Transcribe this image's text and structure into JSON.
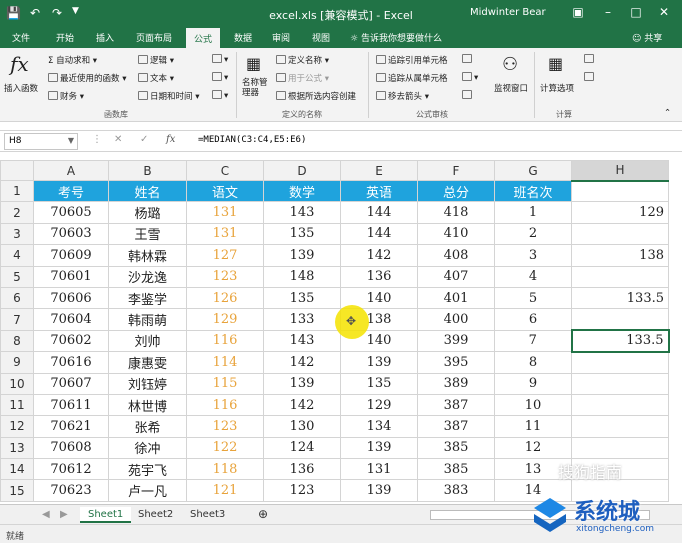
{
  "window": {
    "title": "excel.xls [兼容模式] - Excel",
    "user": "Midwinter Bear",
    "share": "共享"
  },
  "tabs": [
    "文件",
    "开始",
    "插入",
    "页面布局",
    "公式",
    "数据",
    "审阅",
    "视图"
  ],
  "tell_me": "告诉我你想要做什么",
  "ribbon": {
    "insert_function": "插入函数",
    "autosum": "自动求和",
    "recent": "最近使用的函数",
    "financial": "财务",
    "logical": "逻辑",
    "text": "文本",
    "datetime": "日期和时间",
    "group_library": "函数库",
    "name_manager": "名称管理器",
    "define_name": "定义名称",
    "use_in_formula": "用于公式",
    "create_from_sel": "根据所选内容创建",
    "group_names": "定义的名称",
    "trace_precedents": "追踪引用单元格",
    "trace_dependents": "追踪从属单元格",
    "remove_arrows": "移去箭头",
    "group_audit": "公式审核",
    "watch_window": "监视窗口",
    "calc_options": "计算选项",
    "group_calc": "计算"
  },
  "name_box": "H8",
  "formula": "=MEDIAN(C3:C4,E5:E6)",
  "columns": [
    "A",
    "B",
    "C",
    "D",
    "E",
    "F",
    "G",
    "H"
  ],
  "headers": [
    "考号",
    "姓名",
    "语文",
    "数学",
    "英语",
    "总分",
    "班名次"
  ],
  "rows": [
    {
      "n": "2",
      "a": "70605",
      "b": "杨璐",
      "c": "131",
      "d": "143",
      "e": "144",
      "f": "418",
      "g": "1",
      "h": "129"
    },
    {
      "n": "3",
      "a": "70603",
      "b": "王雪",
      "c": "131",
      "d": "135",
      "e": "144",
      "f": "410",
      "g": "2",
      "h": ""
    },
    {
      "n": "4",
      "a": "70609",
      "b": "韩林霖",
      "c": "127",
      "d": "139",
      "e": "142",
      "f": "408",
      "g": "3",
      "h": "138"
    },
    {
      "n": "5",
      "a": "70601",
      "b": "沙龙逸",
      "c": "123",
      "d": "148",
      "e": "136",
      "f": "407",
      "g": "4",
      "h": ""
    },
    {
      "n": "6",
      "a": "70606",
      "b": "李鉴学",
      "c": "126",
      "d": "135",
      "e": "140",
      "f": "401",
      "g": "5",
      "h": "133.5"
    },
    {
      "n": "7",
      "a": "70604",
      "b": "韩雨萌",
      "c": "129",
      "d": "133",
      "e": "138",
      "f": "400",
      "g": "6",
      "h": ""
    },
    {
      "n": "8",
      "a": "70602",
      "b": "刘帅",
      "c": "116",
      "d": "143",
      "e": "140",
      "f": "399",
      "g": "7",
      "h": "133.5"
    },
    {
      "n": "9",
      "a": "70616",
      "b": "康惠雯",
      "c": "114",
      "d": "142",
      "e": "139",
      "f": "395",
      "g": "8",
      "h": ""
    },
    {
      "n": "10",
      "a": "70607",
      "b": "刘钰婷",
      "c": "115",
      "d": "139",
      "e": "135",
      "f": "389",
      "g": "9",
      "h": ""
    },
    {
      "n": "11",
      "a": "70611",
      "b": "林世博",
      "c": "116",
      "d": "142",
      "e": "129",
      "f": "387",
      "g": "10",
      "h": ""
    },
    {
      "n": "12",
      "a": "70621",
      "b": "张希",
      "c": "123",
      "d": "130",
      "e": "134",
      "f": "387",
      "g": "11",
      "h": ""
    },
    {
      "n": "13",
      "a": "70608",
      "b": "徐冲",
      "c": "122",
      "d": "124",
      "e": "139",
      "f": "385",
      "g": "12",
      "h": ""
    },
    {
      "n": "14",
      "a": "70612",
      "b": "苑宇飞",
      "c": "118",
      "d": "136",
      "e": "131",
      "f": "385",
      "g": "13",
      "h": ""
    },
    {
      "n": "15",
      "a": "70623",
      "b": "卢一凡",
      "c": "121",
      "d": "123",
      "e": "139",
      "f": "383",
      "g": "14",
      "h": ""
    }
  ],
  "sheets": [
    "Sheet1",
    "Sheet2",
    "Sheet3"
  ],
  "status": "就绪",
  "watermark": {
    "brand": "系统城",
    "url": "xitongcheng.com",
    "overlay": "搜狗指南"
  },
  "colors": {
    "excel_green": "#217346",
    "header_fill": "#1fa3dd",
    "score_gold": "#e8a33b"
  }
}
